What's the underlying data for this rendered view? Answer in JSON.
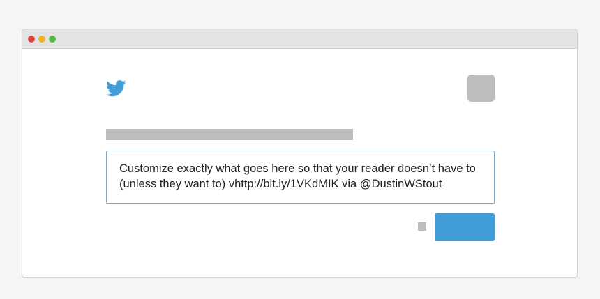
{
  "window": {
    "buttons": [
      {
        "name": "close",
        "color": "#e0443e"
      },
      {
        "name": "minimize",
        "color": "#f2b225"
      },
      {
        "name": "maximize",
        "color": "#56b748"
      }
    ]
  },
  "tweet": {
    "brand_icon": "twitter-bird-icon",
    "brand_color": "#419cd8",
    "text": "Customize exactly what goes here so that your reader doesn’t have to (unless they want to) vhttp://bit.ly/1VKdMIK via @DustinWStout",
    "button_color": "#419cd8",
    "placeholder_color": "#bdbdbd"
  }
}
